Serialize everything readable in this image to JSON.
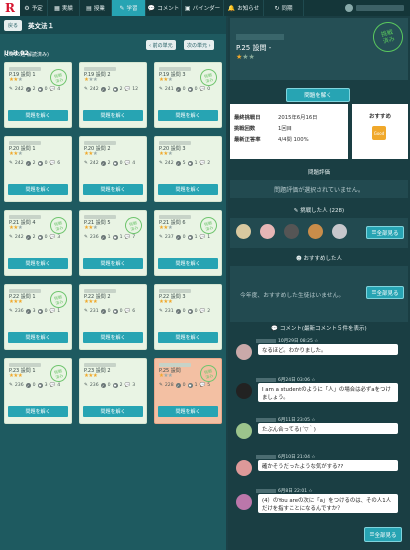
{
  "nav": {
    "logo": "R",
    "items": [
      "予定",
      "実績",
      "授業",
      "学習",
      "コメント",
      "バインダー",
      "お知らせ",
      "同期"
    ],
    "active": 3
  },
  "header": {
    "back": "戻る",
    "title": "英文法１"
  },
  "unit": {
    "name": "Unit 02",
    "progress": "(15/15題 解読済み)",
    "prev": "前の単元",
    "next": "次の単元"
  },
  "cards": [
    {
      "t": "P.19 設問 1",
      "s": 2,
      "n": "242",
      "a": "2",
      "b": "0",
      "c": "4",
      "stamp": true
    },
    {
      "t": "P.19 設問 2",
      "s": 1,
      "n": "242",
      "a": "2",
      "b": "2",
      "c": "12",
      "stamp": false
    },
    {
      "t": "P.19 設問 3",
      "s": 2,
      "n": "241",
      "a": "0",
      "b": "0",
      "c": "0",
      "stamp": true
    },
    {
      "t": "P.20 設問 1",
      "s": 2,
      "n": "242",
      "a": "2",
      "b": "0",
      "c": "6",
      "stamp": false
    },
    {
      "t": "P.20 設問 2",
      "s": 2,
      "n": "242",
      "a": "2",
      "b": "0",
      "c": "4",
      "stamp": false
    },
    {
      "t": "P.20 設問 3",
      "s": 2,
      "n": "242",
      "a": "5",
      "b": "1",
      "c": "2",
      "stamp": false
    },
    {
      "t": "P.21 設問 4",
      "s": 2,
      "n": "242",
      "a": "2",
      "b": "0",
      "c": "3",
      "stamp": true
    },
    {
      "t": "P.21 設問 5",
      "s": 2,
      "n": "236",
      "a": "1",
      "b": "1",
      "c": "7",
      "stamp": true
    },
    {
      "t": "P.21 設問 6",
      "s": 2,
      "n": "237",
      "a": "0",
      "b": "1",
      "c": "1",
      "stamp": true
    },
    {
      "t": "P.22 設問 1",
      "s": 3,
      "n": "236",
      "a": "3",
      "b": "0",
      "c": "1",
      "stamp": true
    },
    {
      "t": "P.22 設問 2",
      "s": 3,
      "n": "231",
      "a": "0",
      "b": "0",
      "c": "6",
      "stamp": false
    },
    {
      "t": "P.22 設問 3",
      "s": 3,
      "n": "231",
      "a": "0",
      "b": "0",
      "c": "2",
      "stamp": false
    },
    {
      "t": "P.23 設問 1",
      "s": 3,
      "n": "236",
      "a": "0",
      "b": "3",
      "c": "4",
      "stamp": true
    },
    {
      "t": "P.23 設問 2",
      "s": 3,
      "n": "236",
      "a": "0",
      "b": "2",
      "c": "3",
      "stamp": false
    },
    {
      "t": "P.25 設問",
      "s": 1,
      "n": "228",
      "a": "0",
      "b": "1",
      "c": "5",
      "stamp": true,
      "hl": true
    }
  ],
  "solve": "問題を解く",
  "stamp": "挑戦\n済み",
  "detail": {
    "title": "P.25 設問 -",
    "solve": "問題を解く",
    "stamp": "挑戦\n済み",
    "rows": [
      [
        "最終挑戦日",
        "2015年6月16日"
      ],
      [
        "挑戦回数",
        "1回目"
      ],
      [
        "最新正答率",
        "4/4問 100%"
      ]
    ],
    "recommend": "おすすめ",
    "recommend_icon": "Good",
    "eval_h": "問題評価",
    "eval_msg": "問題評価が選択されていません。",
    "challengers_h": "挑戦した人 (228)",
    "see_all": "全部見る",
    "rec_h": "おすすめした人",
    "rec_msg": "今年度、おすすめした生徒はいません。",
    "comments_h": "コメント(最新コメント５件を表示)",
    "comments": [
      {
        "d": "10月29日 08:25",
        "t": "なるほど。わかりました。",
        "c": "#c9a9a9"
      },
      {
        "d": "6月24日 03:06",
        "t": "I am a studentのように「人」の場合は必ずaをつけましょう。",
        "c": "#222"
      },
      {
        "d": "6月11日 23:05",
        "t": "たぶん合ってる(´▽｀)",
        "c": "#9cc48c"
      },
      {
        "d": "6月10日 21:04",
        "t": "確かそうだったような気がする??",
        "c": "#d99"
      },
      {
        "d": "6月8日 22:01",
        "t": "(4）のYou areの次に「a」をつけるのは、その人1人だけを指すことになるんですか？",
        "c": "#b7a"
      }
    ],
    "all": "全部見る"
  }
}
